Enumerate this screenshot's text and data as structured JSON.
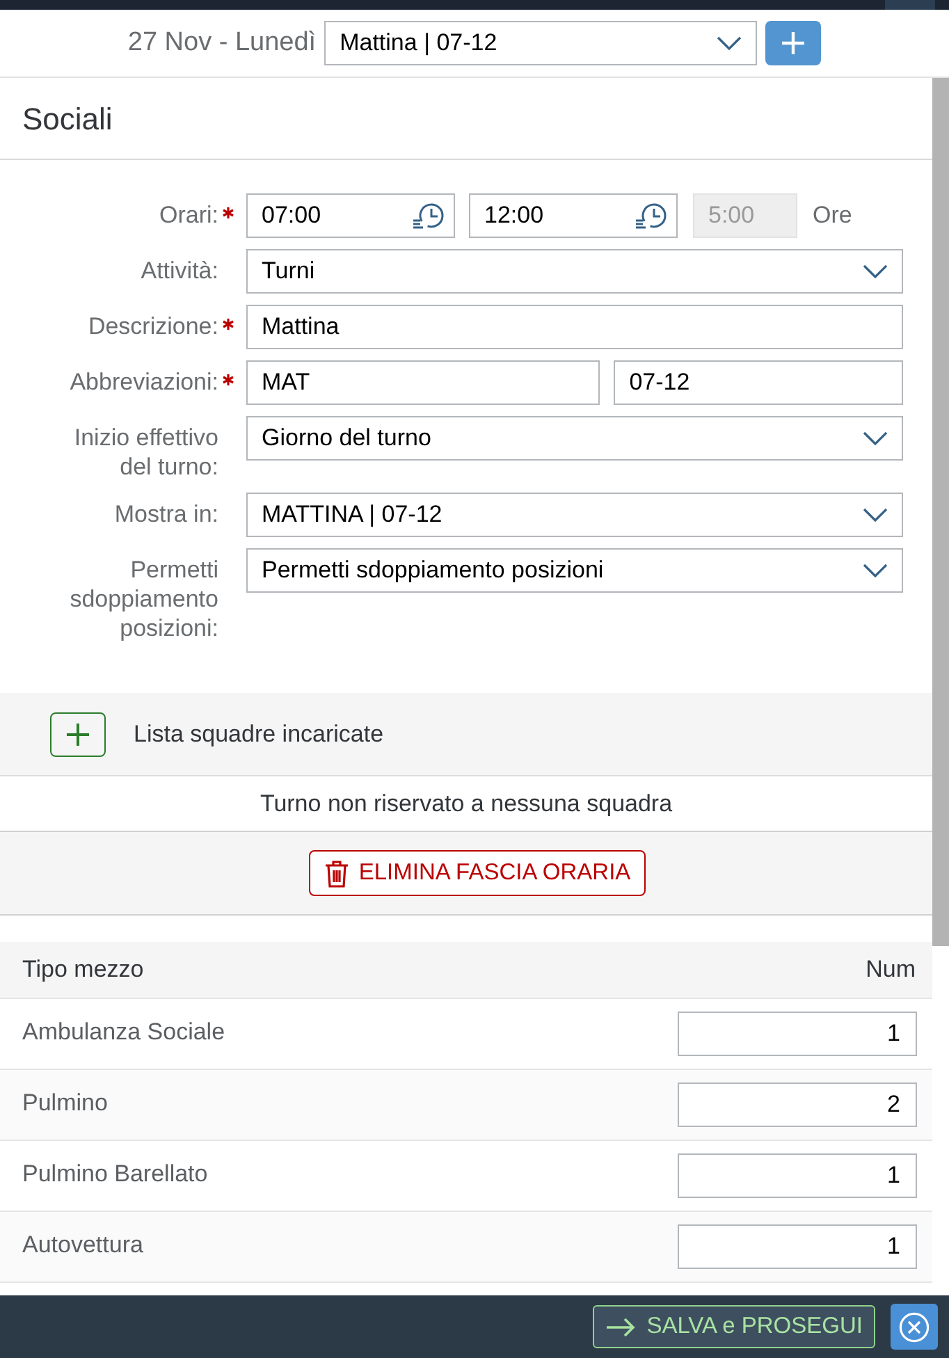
{
  "header": {
    "date": "27 Nov - Lunedì",
    "shift": "Mattina | 07-12"
  },
  "panel_title": "Sociali",
  "form": [
    {
      "kind": "time_range",
      "label": "Orari:",
      "required": true,
      "start": "07:00",
      "end": "12:00",
      "duration": {
        "value": "5:00",
        "disabled": true
      },
      "unit": "Ore"
    },
    {
      "kind": "select",
      "label": "Attività:",
      "required": false,
      "value": "Turni"
    },
    {
      "kind": "text",
      "label": "Descrizione:",
      "required": true,
      "value": "Mattina"
    },
    {
      "kind": "text_pair",
      "label": "Abbreviazioni:",
      "required": true,
      "values": [
        "MAT",
        "07-12"
      ]
    },
    {
      "kind": "select",
      "label": "Inizio effettivo del turno:",
      "required": false,
      "value": "Giorno del turno"
    },
    {
      "kind": "select",
      "label": "Mostra in:",
      "required": false,
      "value": "MATTINA | 07-12"
    },
    {
      "kind": "select",
      "label": "Permetti sdoppiamento posizioni:",
      "required": false,
      "value": "Permetti sdoppiamento posizioni"
    }
  ],
  "teams": {
    "title": "Lista squadre incaricate",
    "message": "Turno non riservato a nessuna squadra"
  },
  "delete_button": "ELIMINA FASCIA ORARIA",
  "vehicles": {
    "columns": [
      "Tipo mezzo",
      "Num"
    ],
    "rows": [
      {
        "type": "Ambulanza Sociale",
        "num": "1"
      },
      {
        "type": "Pulmino",
        "num": "2"
      },
      {
        "type": "Pulmino Barellato",
        "num": "1"
      },
      {
        "type": "Autovettura",
        "num": "1"
      }
    ]
  },
  "footer": {
    "buttons": [
      {
        "kind": "save",
        "label": "SALVA e PROSEGUI"
      },
      {
        "kind": "close"
      }
    ]
  }
}
